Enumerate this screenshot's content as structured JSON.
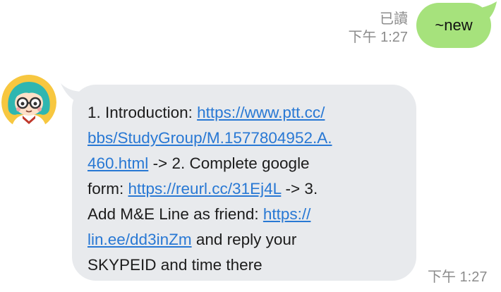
{
  "sent": {
    "read_status": "已讀",
    "time": "下午 1:27",
    "text": "~new"
  },
  "received": {
    "time": "下午 1:27",
    "segments": [
      {
        "text": "1. Introduction: ",
        "link": false
      },
      {
        "text": "https://www.ptt.cc/bbs/StudyGroup/M.1577804952.A.460.html",
        "link": true
      },
      {
        "text": " -> 2. Complete google form:  ",
        "link": false
      },
      {
        "text": "https://reurl.cc/31Ej4L",
        "link": true
      },
      {
        "text": " -> 3. Add M&E Line as friend: ",
        "link": false
      },
      {
        "text": "https://lin.ee/dd3inZm",
        "link": true
      },
      {
        "text": " and reply your SKYPEID and time there",
        "link": false
      }
    ],
    "lines": [
      [
        {
          "t": "1. Introduction: "
        },
        {
          "t": "https://www.ptt.cc/",
          "a": 1
        }
      ],
      [
        {
          "t": "bbs/StudyGroup/M.1577804952.A.",
          "a": 1
        }
      ],
      [
        {
          "t": "460.html",
          "a": 1
        },
        {
          "t": " -> 2. Complete google"
        }
      ],
      [
        {
          "t": "form:  "
        },
        {
          "t": "https://reurl.cc/31Ej4L",
          "a": 2
        },
        {
          "t": " -> 3."
        }
      ],
      [
        {
          "t": "Add M&E Line as friend: "
        },
        {
          "t": "https://",
          "a": 3
        }
      ],
      [
        {
          "t": "lin.ee/dd3inZm",
          "a": 3
        },
        {
          "t": " and reply your"
        }
      ],
      [
        {
          "t": "SKYPEID and time there"
        }
      ]
    ]
  },
  "colors": {
    "sent_bubble": "#a6e27c",
    "received_bubble": "#e8eaed",
    "link": "#2878d4",
    "meta_text": "#8c8c8c"
  },
  "icons": {
    "avatar": "girl-with-glasses-avatar-icon"
  }
}
